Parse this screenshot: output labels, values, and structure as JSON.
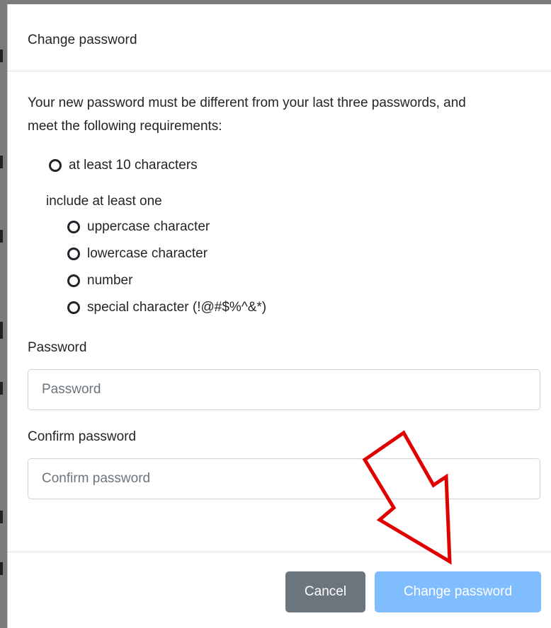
{
  "modal": {
    "title": "Change password",
    "intro": "Your new password must be different from your last three passwords, and meet the following requirements:",
    "requirements": {
      "length": "at least 10 characters",
      "include_label": "include at least one",
      "items": [
        "uppercase character",
        "lowercase character",
        "number",
        "special character (!@#$%^&*)"
      ]
    },
    "password": {
      "label": "Password",
      "placeholder": "Password",
      "value": ""
    },
    "confirm": {
      "label": "Confirm password",
      "placeholder": "Confirm password",
      "value": ""
    },
    "footer": {
      "cancel_label": "Cancel",
      "submit_label": "Change password"
    }
  },
  "icons": {
    "requirement": "circle-outline-icon",
    "annotation": "red-arrow-icon"
  },
  "colors": {
    "cancel_bg": "#6c757d",
    "submit_bg": "#80bdff",
    "arrow": "#e00000",
    "backdrop": "#7b7b7b"
  }
}
